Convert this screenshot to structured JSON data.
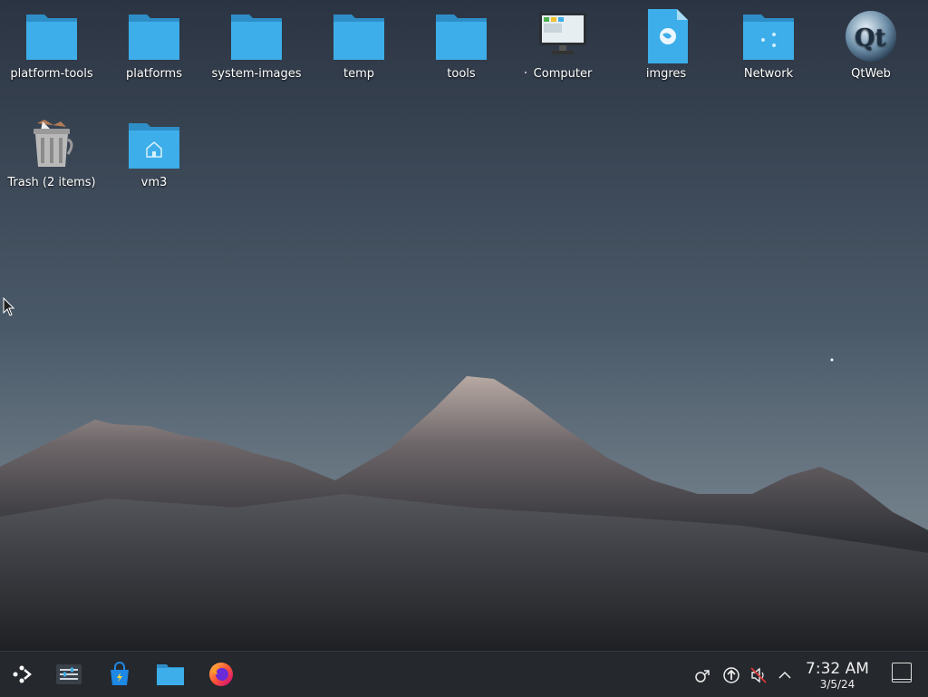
{
  "desktop": {
    "icons": [
      {
        "label": "platform-tools",
        "icon": "folder-icon"
      },
      {
        "label": "platforms",
        "icon": "folder-icon"
      },
      {
        "label": "system-images",
        "icon": "folder-icon"
      },
      {
        "label": "temp",
        "icon": "folder-icon"
      },
      {
        "label": "tools",
        "icon": "folder-icon"
      },
      {
        "label": "Computer",
        "icon": "computer-icon"
      },
      {
        "label": "imgres",
        "icon": "image-file-icon"
      },
      {
        "label": "Network",
        "icon": "network-folder-icon"
      },
      {
        "label": "QtWeb",
        "icon": "qtweb-icon"
      },
      {
        "label": "Trash (2 items)",
        "icon": "trash-full-icon"
      },
      {
        "label": "vm3",
        "icon": "home-folder-icon"
      }
    ]
  },
  "taskbar": {
    "launcher_icon": "application-launcher-icon",
    "pinned": [
      {
        "name": "system-settings-icon"
      },
      {
        "name": "discover-store-icon"
      },
      {
        "name": "file-manager-icon"
      },
      {
        "name": "firefox-icon"
      }
    ]
  },
  "tray": {
    "icons": [
      "network-share-icon",
      "updates-icon",
      "volume-muted-icon",
      "expand-tray-chevron-icon"
    ],
    "clock_time": "7:32 AM",
    "clock_date": "3/5/24"
  },
  "colors": {
    "folder": "#3daee9",
    "panel": "#25282d",
    "text": "#ffffff"
  }
}
